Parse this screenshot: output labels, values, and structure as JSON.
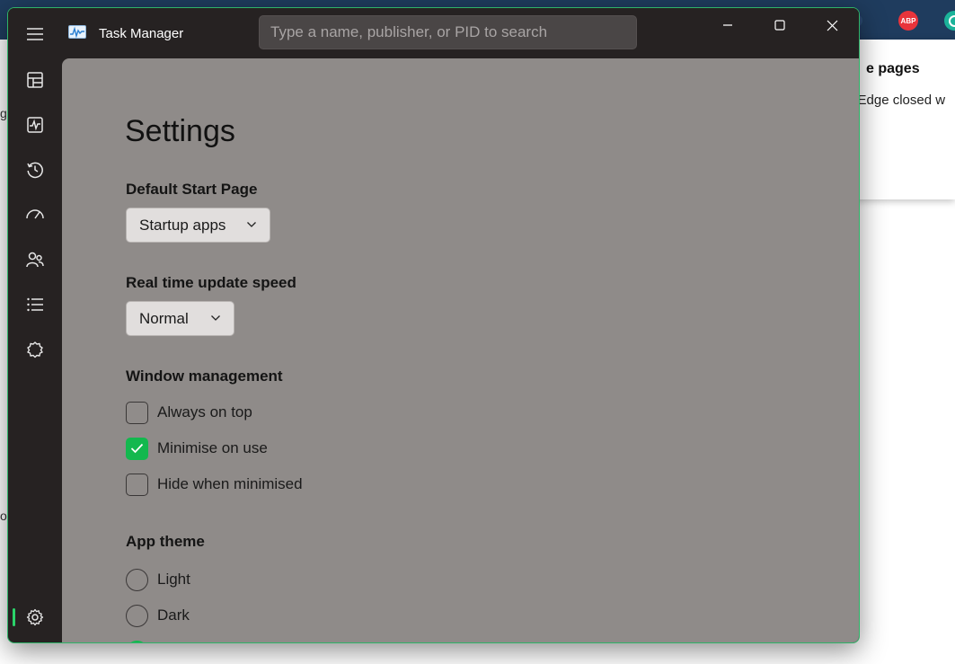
{
  "app": {
    "title": "Task Manager",
    "search_placeholder": "Type a name, publisher, or PID to search"
  },
  "background": {
    "panel_title": "e pages",
    "panel_text": "ft Edge closed w",
    "ext_abp": "ABP",
    "frag_1": "g",
    "frag_2": "o"
  },
  "nav": [
    {
      "icon": "processes-icon"
    },
    {
      "icon": "performance-icon"
    },
    {
      "icon": "app-history-icon"
    },
    {
      "icon": "startup-apps-icon"
    },
    {
      "icon": "users-icon"
    },
    {
      "icon": "details-icon"
    },
    {
      "icon": "services-icon"
    }
  ],
  "settings": {
    "title": "Settings",
    "start_page": {
      "label": "Default Start Page",
      "value": "Startup apps"
    },
    "update_speed": {
      "label": "Real time update speed",
      "value": "Normal"
    },
    "window_management": {
      "label": "Window management",
      "options": [
        {
          "label": "Always on top",
          "checked": false
        },
        {
          "label": "Minimise on use",
          "checked": true
        },
        {
          "label": "Hide when minimised",
          "checked": false
        }
      ]
    },
    "app_theme": {
      "label": "App theme",
      "options": [
        {
          "label": "Light",
          "checked": false
        },
        {
          "label": "Dark",
          "checked": false
        },
        {
          "label": "",
          "checked": true
        }
      ]
    }
  },
  "colors": {
    "accent": "#13b84e",
    "window_border": "#2fb368",
    "content_bg": "#8f8b89",
    "nav_bg": "#262222"
  }
}
